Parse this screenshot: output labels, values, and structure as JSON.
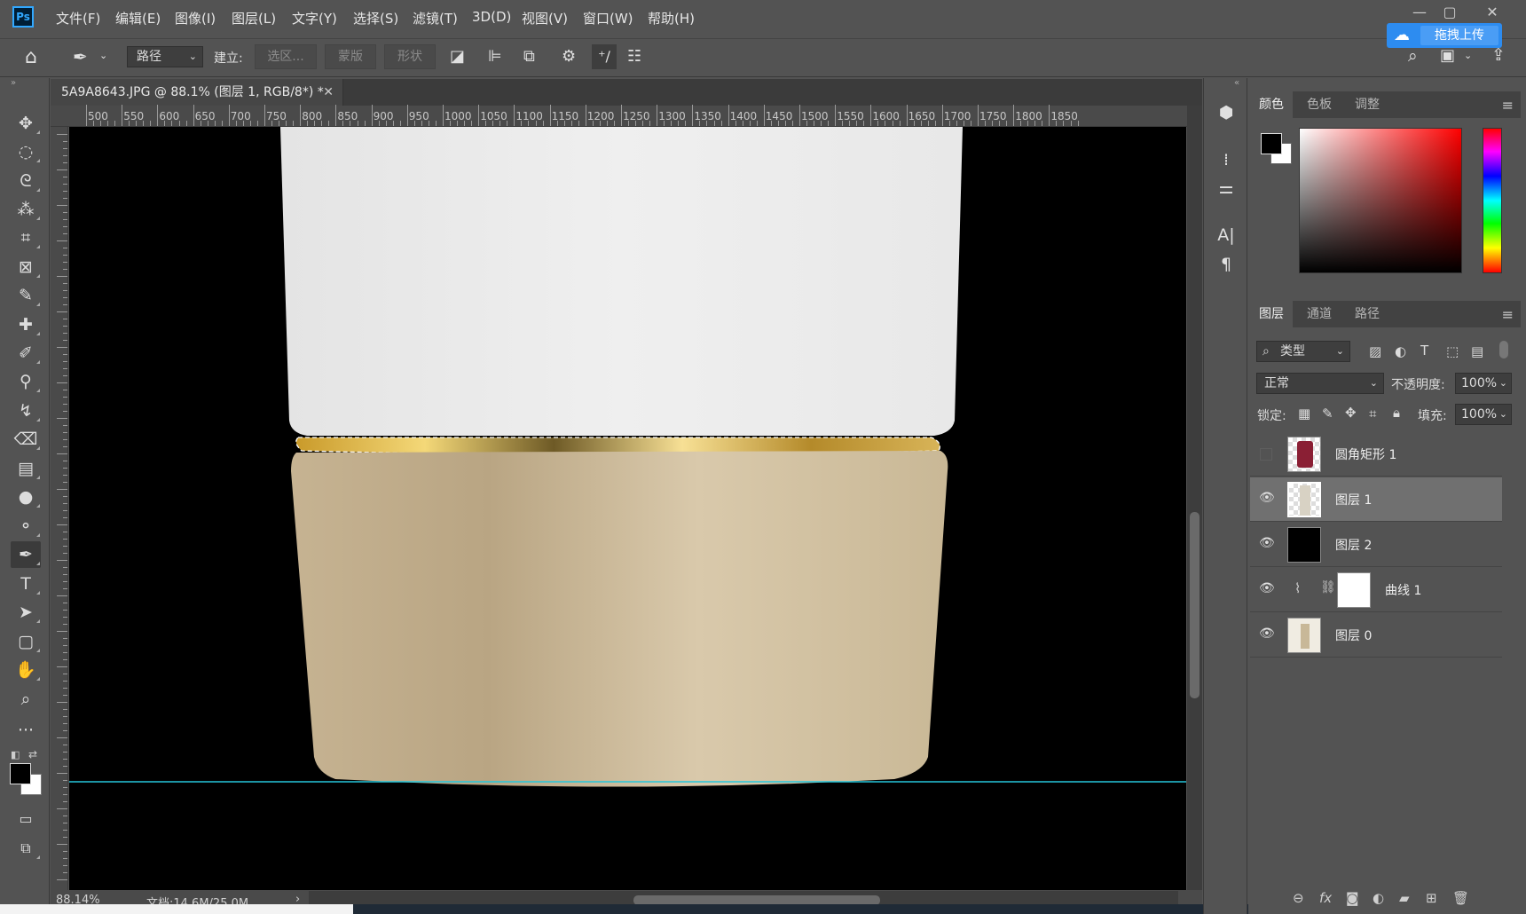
{
  "app": {
    "logo": "Ps"
  },
  "menu": [
    "文件(F)",
    "编辑(E)",
    "图像(I)",
    "图层(L)",
    "文字(Y)",
    "选择(S)",
    "滤镜(T)",
    "3D(D)",
    "视图(V)",
    "窗口(W)",
    "帮助(H)"
  ],
  "window_controls": {
    "minimize": "—",
    "maximize": "▢",
    "close": "✕"
  },
  "cloud_upload": {
    "label": "拖拽上传",
    "icon": "cloud-icon"
  },
  "options_bar": {
    "mode_value": "路径",
    "make_label": "建立:",
    "selection_btn": "选区...",
    "mask_btn": "蒙版",
    "shape_btn": "形状"
  },
  "document_tab": {
    "title": "5A9A8643.JPG @ 88.1% (图层 1, RGB/8*) *",
    "close": "✕"
  },
  "ruler": {
    "ticks": [
      "500",
      "550",
      "600",
      "650",
      "700",
      "750",
      "800",
      "850",
      "900",
      "950",
      "1000",
      "1050",
      "1100",
      "1150",
      "1200",
      "1250",
      "1300",
      "1350",
      "1400",
      "1450",
      "1500",
      "1550",
      "1600",
      "1650",
      "1700",
      "1750",
      "1800",
      "1850"
    ]
  },
  "status": {
    "zoom": "88.14%",
    "doc": "文档:14.6M/25.0M",
    "arrow": "›"
  },
  "color_panel": {
    "tabs": [
      "颜色",
      "色板",
      "调整"
    ],
    "active": 0,
    "foreground": "#000000",
    "background": "#ffffff"
  },
  "layers_panel": {
    "tabs": [
      "图层",
      "通道",
      "路径"
    ],
    "active": 0,
    "filter_value": "类型",
    "blend_mode": "正常",
    "opacity_label": "不透明度:",
    "opacity_value": "100%",
    "lock_label": "锁定:",
    "fill_label": "填充:",
    "fill_value": "100%",
    "layers": [
      {
        "name": "圆角矩形 1",
        "visible": false,
        "selected": false,
        "thumb": "#8a1f34"
      },
      {
        "name": "图层 1",
        "visible": true,
        "selected": true,
        "thumb": "#d8d2c4"
      },
      {
        "name": "图层 2",
        "visible": true,
        "selected": false,
        "thumb": "#000000"
      },
      {
        "name": "曲线 1",
        "visible": true,
        "selected": false,
        "thumb": "#ffffff"
      },
      {
        "name": "图层 0",
        "visible": true,
        "selected": false,
        "thumb": "#e4dcc8"
      }
    ]
  }
}
